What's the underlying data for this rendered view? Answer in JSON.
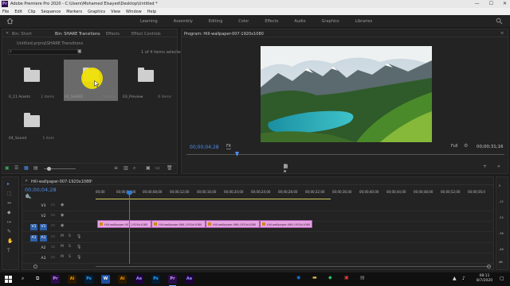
{
  "window": {
    "app_icon": "Pr",
    "title": "Adobe Premiere Pro 2020 - C:\\Users\\Mohamed Elsayed\\Desktop\\Untitled *",
    "controls": [
      "—",
      "☐",
      "✕"
    ]
  },
  "menu": [
    "File",
    "Edit",
    "Clip",
    "Sequence",
    "Markers",
    "Graphics",
    "View",
    "Window",
    "Help"
  ],
  "workspaces": [
    "Learning",
    "Assembly",
    "Editing",
    "Color",
    "Effects",
    "Audio",
    "Graphics",
    "Libraries"
  ],
  "project_panel": {
    "tabs": [
      "Bin: Short",
      "Bin: SHARE Transitions",
      "Effects",
      "Effect Controls"
    ],
    "path": "Untitled.prproj\\SHARE Transitions",
    "items_selected": "1 of 4 items selected",
    "bins": [
      {
        "name": "0_11 Assets",
        "count": "2 items"
      },
      {
        "name": "02_SHARE",
        "count": "4 items"
      },
      {
        "name": "03_Preview",
        "count": "6 items"
      },
      {
        "name": "04_Sound",
        "count": "1 item"
      }
    ]
  },
  "program_monitor": {
    "title": "Program: Hill-wallpaper-007-1920x1080",
    "timecode_left": "00;00;04;28",
    "fit_label": "Fit",
    "timecode_right": "00;00;31;16",
    "quality": "Full"
  },
  "timeline": {
    "sequence_tab": "Hill-wallpaper-007-1920x1080",
    "timecode": "00;00;04;28",
    "ruler": [
      "00;00",
      "00;00;04;00",
      "00;00;08;00",
      "00;00;12;00",
      "00;00;16;00",
      "00;00;20;00",
      "00;00;24;00",
      "00;00;28;00",
      "00;00;32;00",
      "00;00;36;00",
      "00;00;40;00",
      "00;00;44;00",
      "00;00;48;00",
      "00;00;52;00",
      "00;00;56;0"
    ],
    "video_tracks": [
      "V3",
      "V2",
      "V1"
    ],
    "audio_tracks": [
      "A1",
      "A2",
      "A3"
    ],
    "clips": [
      "Hill-wallpaper-007-1920x1080",
      "Hill-wallpaper-064-1920x1080",
      "Hill-wallpaper-066-1920x1080",
      "Hill-wallpaper-069-1920x1080"
    ]
  },
  "tools": [
    "▸",
    "⬚",
    "↔",
    "◆",
    "↦",
    "✎",
    "✋",
    "T"
  ],
  "meters": {
    "db": [
      "0",
      "-12",
      "-24",
      "-36",
      "-48"
    ],
    "unit": "dB"
  },
  "taskbar": {
    "time": "08:11",
    "date": "8/7/2020",
    "apps": [
      {
        "label": "Pr",
        "color": "#2a0e4a",
        "fg": "#d79cff"
      },
      {
        "label": "Ai",
        "color": "#2b1a00",
        "fg": "#ff9a00"
      },
      {
        "label": "Ps",
        "color": "#001e36",
        "fg": "#31a8ff"
      },
      {
        "label": "W",
        "color": "#1e4fa0",
        "fg": "#ffffff"
      },
      {
        "label": "Ai",
        "color": "#2b1a00",
        "fg": "#ff9a00"
      },
      {
        "label": "Ae",
        "color": "#1f0040",
        "fg": "#9999ff"
      },
      {
        "label": "Ps",
        "color": "#001e36",
        "fg": "#31a8ff"
      },
      {
        "label": "Pr",
        "color": "#2a0e4a",
        "fg": "#d79cff"
      },
      {
        "label": "Ae",
        "color": "#1f0040",
        "fg": "#9999ff"
      }
    ]
  },
  "colors": {
    "accent_blue": "#4d8ef0",
    "clip_pink": "#e7a4e3",
    "playhead_blue": "#2f7cd6"
  }
}
